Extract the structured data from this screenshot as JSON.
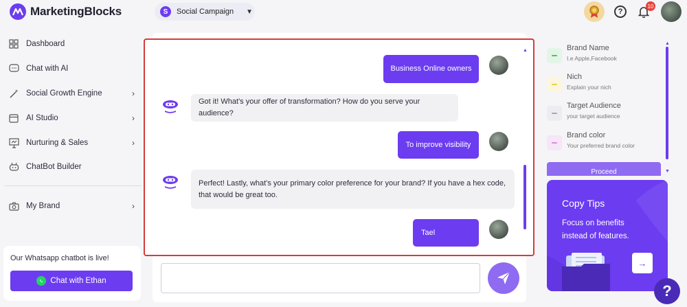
{
  "app": {
    "brand": "MarketingBlocks",
    "campaign_badge": "S",
    "campaign_name": "Social Campaign",
    "notification_count": "10"
  },
  "sidebar": {
    "items": [
      {
        "label": "Dashboard",
        "icon": "grid-icon"
      },
      {
        "label": "Chat with AI",
        "icon": "chat-icon"
      },
      {
        "label": "Social Growth Engine",
        "icon": "magic-wand-icon"
      },
      {
        "label": "AI Studio",
        "icon": "studio-icon"
      },
      {
        "label": "Nurturing & Sales",
        "icon": "presentation-icon"
      },
      {
        "label": "ChatBot Builder",
        "icon": "bot-icon"
      },
      {
        "label": "My Brand",
        "icon": "camera-icon"
      }
    ],
    "whatsapp_text": "Our Whatsapp chatbot is live!",
    "whatsapp_button": "Chat with Ethan"
  },
  "chat": {
    "messages": [
      {
        "from": "user",
        "text": "Business Online owners"
      },
      {
        "from": "bot",
        "text": "Got it! What's your offer of transformation? How do you serve your audience?"
      },
      {
        "from": "user",
        "text": "To improve visibility"
      },
      {
        "from": "bot",
        "text": "Perfect! Lastly, what's your primary color preference for your brand? If you have a hex code, that would be great too."
      },
      {
        "from": "user",
        "text": "Tael"
      }
    ],
    "input_value": ""
  },
  "brand_panel": {
    "fields": [
      {
        "title": "Brand Name",
        "sub": "I.e Apple,Facebook",
        "chip_bg": "#e3f5e6",
        "chip_fg": "#4bc16a"
      },
      {
        "title": "Nich",
        "sub": "Explain your nich",
        "chip_bg": "#fbf6dc",
        "chip_fg": "#e9cf4f"
      },
      {
        "title": "Target Audience",
        "sub": "your target audience",
        "chip_bg": "#ececf1",
        "chip_fg": "#a9a9b6"
      },
      {
        "title": "Brand color",
        "sub": "Your preferred brand color",
        "chip_bg": "#f6e6f8",
        "chip_fg": "#d98ae3"
      }
    ],
    "proceed_label": "Proceed"
  },
  "tips": {
    "title": "Copy Tips",
    "text": "Focus on benefits instead of features."
  },
  "colors": {
    "accent": "#6c3cf0",
    "highlight_border": "#d63a3a"
  }
}
